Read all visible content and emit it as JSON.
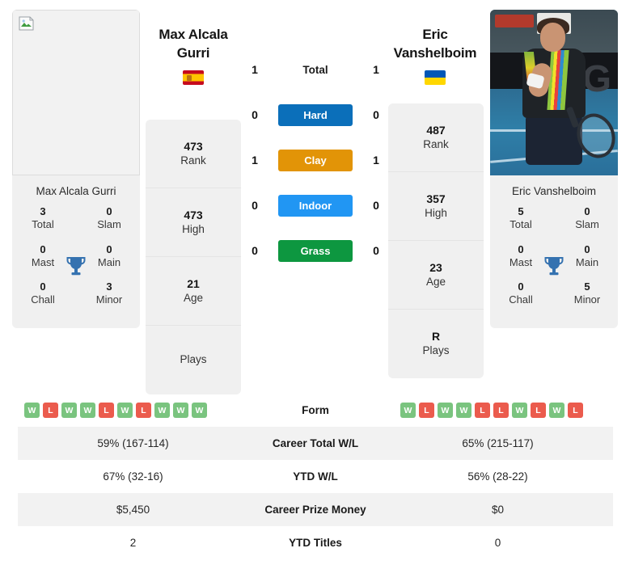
{
  "players": {
    "left": {
      "name": "Max Alcala Gurri",
      "name_line1": "Max Alcala",
      "name_line2": "Gurri",
      "country_flag": "flag-spain",
      "photo_state": "broken-image",
      "card_caption": "Max Alcala Gurri",
      "titles": {
        "total_value": "3",
        "total_label": "Total",
        "slam_value": "0",
        "slam_label": "Slam",
        "mast_value": "0",
        "mast_label": "Mast",
        "main_value": "0",
        "main_label": "Main",
        "chall_value": "0",
        "chall_label": "Chall",
        "minor_value": "3",
        "minor_label": "Minor",
        "trophy_icon": "trophy-icon"
      },
      "stats": [
        {
          "value": "473",
          "label": "Rank"
        },
        {
          "value": "473",
          "label": "High"
        },
        {
          "value": "21",
          "label": "Age"
        },
        {
          "value": "",
          "label": "Plays"
        }
      ],
      "surface_wins": {
        "total": "1",
        "hard": "0",
        "clay": "1",
        "indoor": "0",
        "grass": "0"
      },
      "form": [
        "W",
        "L",
        "W",
        "W",
        "L",
        "W",
        "L",
        "W",
        "W",
        "W"
      ],
      "career_total_wl": "59% (167-114)",
      "ytd_wl": "67% (32-16)",
      "career_prize_money": "$5,450",
      "ytd_titles": "2"
    },
    "right": {
      "name": "Eric Vanshelboim",
      "name_line1": "Eric",
      "name_line2": "Vanshelboim",
      "country_flag": "flag-ukraine",
      "photo_state": "photo",
      "card_caption": "Eric Vanshelboim",
      "titles": {
        "total_value": "5",
        "total_label": "Total",
        "slam_value": "0",
        "slam_label": "Slam",
        "mast_value": "0",
        "mast_label": "Mast",
        "main_value": "0",
        "main_label": "Main",
        "chall_value": "0",
        "chall_label": "Chall",
        "minor_value": "5",
        "minor_label": "Minor",
        "trophy_icon": "trophy-icon"
      },
      "stats": [
        {
          "value": "487",
          "label": "Rank"
        },
        {
          "value": "357",
          "label": "High"
        },
        {
          "value": "23",
          "label": "Age"
        },
        {
          "value": "R",
          "label": "Plays"
        }
      ],
      "surface_wins": {
        "total": "1",
        "hard": "0",
        "clay": "1",
        "indoor": "0",
        "grass": "0"
      },
      "form": [
        "W",
        "L",
        "W",
        "W",
        "L",
        "L",
        "W",
        "L",
        "W",
        "L"
      ],
      "career_total_wl": "65% (215-117)",
      "ytd_wl": "56% (28-22)",
      "career_prize_money": "$0",
      "ytd_titles": "0"
    }
  },
  "surfaces": [
    {
      "key": "total",
      "label": "Total",
      "color": "transparent",
      "style": "plain"
    },
    {
      "key": "hard",
      "label": "Hard",
      "color": "#0b6fba",
      "style": "pill"
    },
    {
      "key": "clay",
      "label": "Clay",
      "color": "#e29407",
      "style": "pill"
    },
    {
      "key": "indoor",
      "label": "Indoor",
      "color": "#2196f3",
      "style": "pill"
    },
    {
      "key": "grass",
      "label": "Grass",
      "color": "#0d9740",
      "style": "pill"
    }
  ],
  "stats_table": {
    "rows": [
      {
        "key": "form",
        "label": "Form",
        "type": "form",
        "shaded": false
      },
      {
        "key": "career",
        "label": "Career Total W/L",
        "type": "text",
        "shaded": true,
        "left": "59% (167-114)",
        "right": "65% (215-117)"
      },
      {
        "key": "ytd_wl",
        "label": "YTD W/L",
        "type": "text",
        "shaded": false,
        "left": "67% (32-16)",
        "right": "56% (28-22)"
      },
      {
        "key": "prize",
        "label": "Career Prize Money",
        "type": "text",
        "shaded": true,
        "left": "$5,450",
        "right": "$0"
      },
      {
        "key": "titles",
        "label": "YTD Titles",
        "type": "text",
        "shaded": false,
        "left": "2",
        "right": "0"
      }
    ]
  },
  "colors": {
    "hard": "#0b6fba",
    "clay": "#e29407",
    "indoor": "#2196f3",
    "grass": "#0d9740",
    "win": "#7ac47f",
    "loss": "#eb5b4d",
    "panel": "#f0f0f0",
    "stripe": "#f2f2f2",
    "trophy": "#3572b0"
  }
}
